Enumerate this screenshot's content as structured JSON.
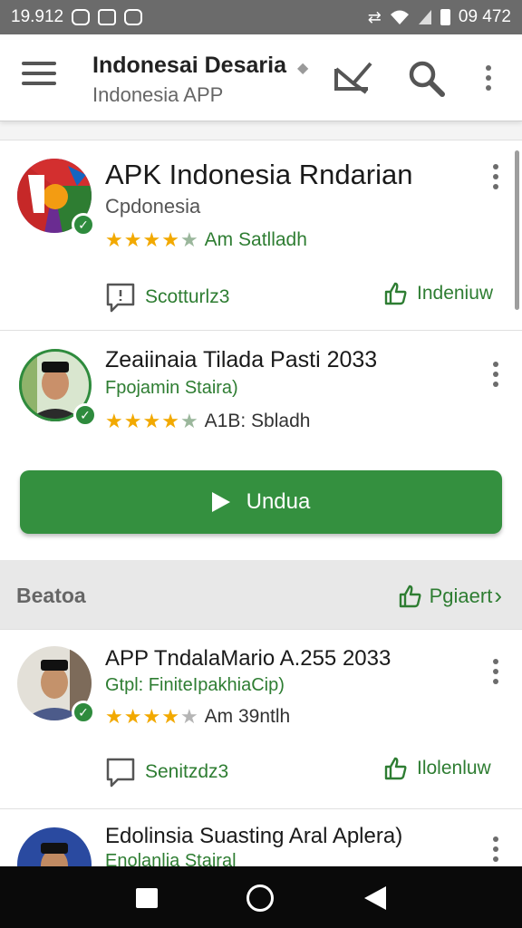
{
  "status_bar": {
    "time": "19.912",
    "clock_right": "09 472"
  },
  "app_bar": {
    "title": "Indonesai Desaria",
    "subtitle": "Indonesia APP",
    "icons": [
      "menu-icon",
      "mail-icon",
      "search-icon",
      "more-vert-icon"
    ]
  },
  "apps": [
    {
      "title": "APK Indonesia Rndarian",
      "developer": "Cpdonesia",
      "stars_full": 4,
      "rating_text": "Am Satlladh",
      "action_left": "Scotturlz3",
      "action_right": "Indeniuw"
    },
    {
      "title": "Zeaiinaia Tilada Pasti 2033",
      "developer": "Fpojamin Staira)",
      "stars_full": 4,
      "rating_text": "A1B: Sbladh",
      "install_label": "Undua"
    },
    {
      "title": "APP TndalaMario A.255 2033",
      "developer": "Gtpl: FiniteIpakhiaCip)",
      "stars_full": 4,
      "rating_text": "Am  39ntlh",
      "action_left": "Senitzdz3",
      "action_right": "Ilolenluw"
    },
    {
      "title": "Edolinsia Suasting Aral Aplera)",
      "developer": "Enolanlia Stairal"
    }
  ],
  "section": {
    "title": "Beatoa",
    "link": "Pgiaert"
  },
  "colors": {
    "accent_green": "#2e7d32",
    "button_green": "#34903f",
    "star_gold": "#f2a900"
  }
}
